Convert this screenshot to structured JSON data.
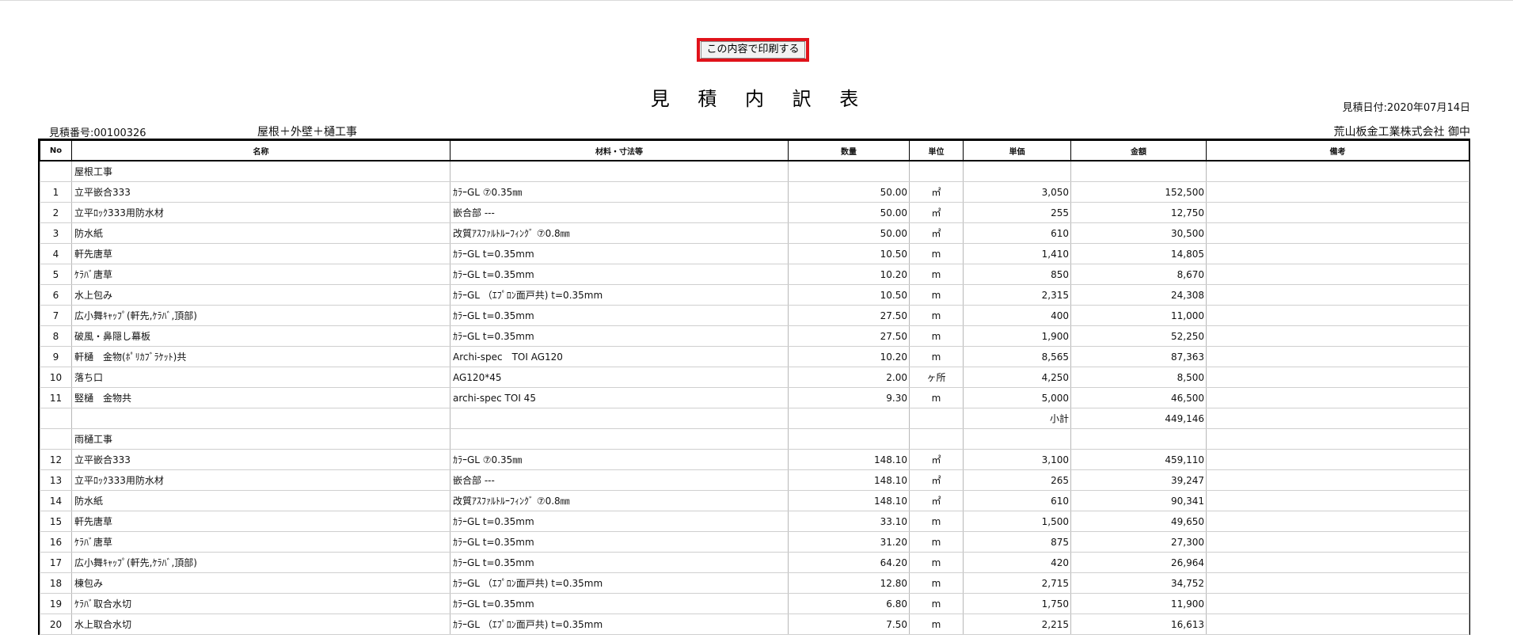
{
  "print_button": {
    "label": "この内容で印刷する"
  },
  "document": {
    "title": "見 積 内 訳 表",
    "estimate_date": "見積日付:2020年07月14日",
    "estimate_no": "見積番号:00100326",
    "project": "屋根＋外壁＋樋工事",
    "client": "荒山板金工業株式会社 御中"
  },
  "table": {
    "columns": [
      "No",
      "名称",
      "材料・寸法等",
      "数量",
      "単位",
      "単価",
      "金額",
      "備考"
    ],
    "rows": [
      {
        "no": "",
        "name": "屋根工事",
        "spec": "",
        "qty": "",
        "unit": "",
        "price": "",
        "amount": "",
        "note": ""
      },
      {
        "no": "1",
        "name": "立平嵌合333",
        "spec": "ｶﾗｰGL ⑦0.35㎜",
        "qty": "50.00",
        "unit": "㎡",
        "price": "3,050",
        "amount": "152,500",
        "note": ""
      },
      {
        "no": "2",
        "name": "立平ﾛｯｸ333用防水材",
        "spec": "嵌合部 ---",
        "qty": "50.00",
        "unit": "㎡",
        "price": "255",
        "amount": "12,750",
        "note": ""
      },
      {
        "no": "3",
        "name": "防水紙",
        "spec": "改質ｱｽﾌｧﾙﾄﾙｰﾌｨﾝｸﾞ ⑦0.8㎜",
        "qty": "50.00",
        "unit": "㎡",
        "price": "610",
        "amount": "30,500",
        "note": ""
      },
      {
        "no": "4",
        "name": "軒先唐草",
        "spec": "ｶﾗｰGL t=0.35mm",
        "qty": "10.50",
        "unit": "m",
        "price": "1,410",
        "amount": "14,805",
        "note": ""
      },
      {
        "no": "5",
        "name": "ｹﾗﾊﾞ唐草",
        "spec": "ｶﾗｰGL t=0.35mm",
        "qty": "10.20",
        "unit": "m",
        "price": "850",
        "amount": "8,670",
        "note": ""
      },
      {
        "no": "6",
        "name": "水上包み",
        "spec": "ｶﾗｰGL （ｴﾌﾟﾛﾝ面戸共) t=0.35mm",
        "qty": "10.50",
        "unit": "m",
        "price": "2,315",
        "amount": "24,308",
        "note": ""
      },
      {
        "no": "7",
        "name": "広小舞ｷｬｯﾌﾟ(軒先,ｹﾗﾊﾞ,頂部)",
        "spec": "ｶﾗｰGL t=0.35mm",
        "qty": "27.50",
        "unit": "m",
        "price": "400",
        "amount": "11,000",
        "note": ""
      },
      {
        "no": "8",
        "name": "破風・鼻隠し幕板",
        "spec": "ｶﾗｰGL t=0.35mm",
        "qty": "27.50",
        "unit": "m",
        "price": "1,900",
        "amount": "52,250",
        "note": ""
      },
      {
        "no": "9",
        "name": "軒樋　金物(ﾎﾟﾘｶﾌﾞﾗｹｯﾄ)共",
        "spec": "Archi-spec　TOI AG120",
        "qty": "10.20",
        "unit": "m",
        "price": "8,565",
        "amount": "87,363",
        "note": ""
      },
      {
        "no": "10",
        "name": "落ち口",
        "spec": "AG120*45",
        "qty": "2.00",
        "unit": "ヶ所",
        "price": "4,250",
        "amount": "8,500",
        "note": ""
      },
      {
        "no": "11",
        "name": "竪樋　金物共",
        "spec": "archi-spec TOI 45",
        "qty": "9.30",
        "unit": "m",
        "price": "5,000",
        "amount": "46,500",
        "note": ""
      },
      {
        "no": "",
        "name": "",
        "spec": "",
        "qty": "",
        "unit": "",
        "price": "小計",
        "amount": "449,146",
        "note": ""
      },
      {
        "no": "",
        "name": "雨樋工事",
        "spec": "",
        "qty": "",
        "unit": "",
        "price": "",
        "amount": "",
        "note": ""
      },
      {
        "no": "12",
        "name": "立平嵌合333",
        "spec": "ｶﾗｰGL ⑦0.35㎜",
        "qty": "148.10",
        "unit": "㎡",
        "price": "3,100",
        "amount": "459,110",
        "note": ""
      },
      {
        "no": "13",
        "name": "立平ﾛｯｸ333用防水材",
        "spec": "嵌合部 ---",
        "qty": "148.10",
        "unit": "㎡",
        "price": "265",
        "amount": "39,247",
        "note": ""
      },
      {
        "no": "14",
        "name": "防水紙",
        "spec": "改質ｱｽﾌｧﾙﾄﾙｰﾌｨﾝｸﾞ ⑦0.8㎜",
        "qty": "148.10",
        "unit": "㎡",
        "price": "610",
        "amount": "90,341",
        "note": ""
      },
      {
        "no": "15",
        "name": "軒先唐草",
        "spec": "ｶﾗｰGL t=0.35mm",
        "qty": "33.10",
        "unit": "m",
        "price": "1,500",
        "amount": "49,650",
        "note": ""
      },
      {
        "no": "16",
        "name": "ｹﾗﾊﾞ唐草",
        "spec": "ｶﾗｰGL t=0.35mm",
        "qty": "31.20",
        "unit": "m",
        "price": "875",
        "amount": "27,300",
        "note": ""
      },
      {
        "no": "17",
        "name": "広小舞ｷｬｯﾌﾟ(軒先,ｹﾗﾊﾞ,頂部)",
        "spec": "ｶﾗｰGL t=0.35mm",
        "qty": "64.20",
        "unit": "m",
        "price": "420",
        "amount": "26,964",
        "note": ""
      },
      {
        "no": "18",
        "name": "棟包み",
        "spec": "ｶﾗｰGL （ｴﾌﾟﾛﾝ面戸共) t=0.35mm",
        "qty": "12.80",
        "unit": "m",
        "price": "2,715",
        "amount": "34,752",
        "note": ""
      },
      {
        "no": "19",
        "name": "ｹﾗﾊﾞ取合水切",
        "spec": "ｶﾗｰGL t=0.35mm",
        "qty": "6.80",
        "unit": "m",
        "price": "1,750",
        "amount": "11,900",
        "note": ""
      },
      {
        "no": "20",
        "name": "水上取合水切",
        "spec": "ｶﾗｰGL （ｴﾌﾟﾛﾝ面戸共) t=0.35mm",
        "qty": "7.50",
        "unit": "m",
        "price": "2,215",
        "amount": "16,613",
        "note": ""
      }
    ]
  },
  "colors": {
    "highlight_border": "#e0121a"
  }
}
